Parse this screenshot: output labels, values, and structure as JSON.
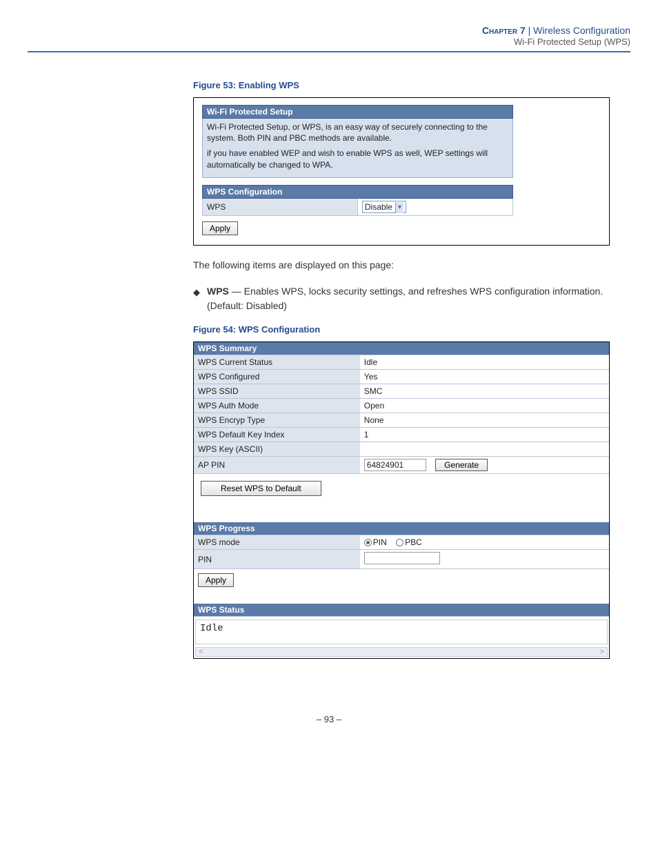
{
  "header": {
    "chapter": "Chapter 7",
    "sep": "|",
    "title": "Wireless Configuration",
    "subtitle": "Wi-Fi Protected Setup (WPS)"
  },
  "fig53": {
    "caption": "Figure 53:  Enabling WPS",
    "panel_title": "Wi-Fi Protected Setup",
    "desc1": "Wi-Fi Protected Setup, or WPS, is an easy way of securely connecting to the system. Both PIN and PBC methods are available.",
    "desc2": "if you have enabled WEP and wish to enable WPS as well, WEP settings will automatically be changed to WPA.",
    "config_title": "WPS Configuration",
    "row_label": "WPS",
    "select_value": "Disable",
    "apply": "Apply"
  },
  "body": {
    "intro": "The following items are displayed on this page:",
    "bullet_strong": "WPS",
    "bullet_text": " — Enables WPS, locks security settings, and refreshes WPS configuration information. (Default: Disabled)"
  },
  "fig54": {
    "caption": "Figure 54:  WPS Configuration",
    "summary_title": "WPS Summary",
    "rows": [
      {
        "label": "WPS Current Status",
        "value": "Idle"
      },
      {
        "label": "WPS Configured",
        "value": "Yes"
      },
      {
        "label": "WPS SSID",
        "value": "SMC"
      },
      {
        "label": "WPS Auth Mode",
        "value": "Open"
      },
      {
        "label": "WPS Encryp Type",
        "value": "None"
      },
      {
        "label": "WPS Default Key Index",
        "value": "1"
      },
      {
        "label": "WPS Key (ASCII)",
        "value": ""
      }
    ],
    "ap_pin_label": "AP PIN",
    "ap_pin_value": "64824901",
    "generate": "Generate",
    "reset_btn": "Reset WPS to Default",
    "progress_title": "WPS Progress",
    "mode_label": "WPS mode",
    "mode_pin": "PIN",
    "mode_pbc": "PBC",
    "pin_label": "PIN",
    "apply": "Apply",
    "status_title": "WPS Status",
    "status_value": "Idle",
    "arrow_left": "<",
    "arrow_right": ">"
  },
  "footer": {
    "page": "– 93 –"
  }
}
